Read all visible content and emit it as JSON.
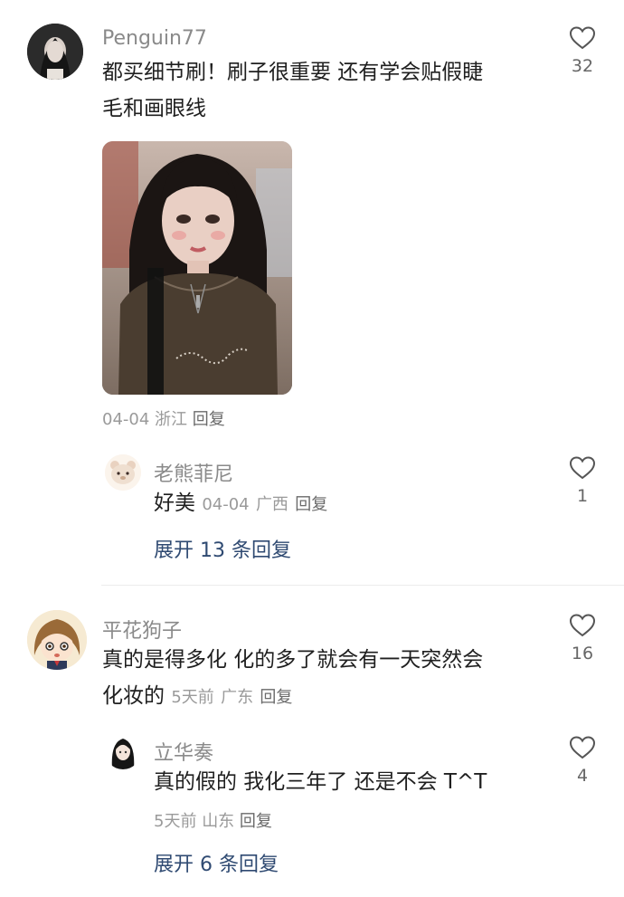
{
  "comments": [
    {
      "username": "Penguin77",
      "text_line1": "都买细节刷！刷子很重要 还有学会贴假睫",
      "text_line2": "毛和画眼线",
      "date": "04-04",
      "location": "浙江",
      "reply_label": "回复",
      "likes": "32",
      "has_photo": true,
      "replies": [
        {
          "username": "老熊菲尼",
          "text": "好美",
          "date": "04-04",
          "location": "广西",
          "reply_label": "回复",
          "likes": "1"
        }
      ],
      "expand_label": "展开 13 条回复"
    },
    {
      "username": "平花狗子",
      "text_line1": "真的是得多化 化的多了就会有一天突然会",
      "text_line2": "化妆的",
      "date": "5天前",
      "location": "广东",
      "reply_label": "回复",
      "likes": "16",
      "replies": [
        {
          "username": "立华奏",
          "text": "真的假的 我化三年了 还是不会 T^T",
          "date": "5天前",
          "location": "山东",
          "reply_label": "回复",
          "likes": "4"
        }
      ],
      "expand_label": "展开 6 条回复"
    }
  ],
  "icons": {
    "like": "heart-outline-icon"
  },
  "colors": {
    "username": "#8a8a8a",
    "meta": "#9a9a9a",
    "expand_link": "#2f4a72"
  }
}
